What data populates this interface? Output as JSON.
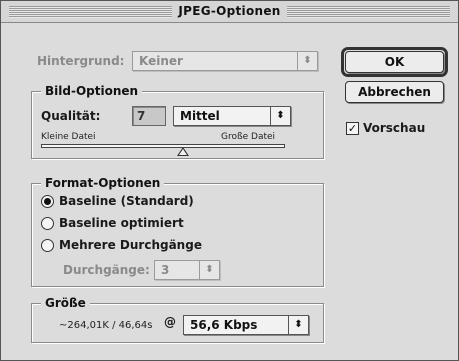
{
  "window": {
    "title": "JPEG-Optionen"
  },
  "background": {
    "label": "Hintergrund:",
    "value": "Keiner"
  },
  "buttons": {
    "ok": "OK",
    "cancel": "Abbrechen"
  },
  "preview": {
    "label": "Vorschau",
    "checked": true
  },
  "bild_optionen": {
    "title": "Bild-Optionen",
    "quality_label": "Qualität:",
    "quality_value": "7",
    "quality_preset": "Mittel",
    "slider_left_label": "Kleine Datei",
    "slider_right_label": "Große Datei",
    "slider_fraction": 0.58
  },
  "format_optionen": {
    "title": "Format-Optionen",
    "options": [
      {
        "label": "Baseline (Standard)",
        "selected": true
      },
      {
        "label": "Baseline optimiert",
        "selected": false
      },
      {
        "label": "Mehrere Durchgänge",
        "selected": false
      }
    ],
    "passes_label": "Durchgänge:",
    "passes_value": "3"
  },
  "groesse": {
    "title": "Größe",
    "size_text": "~264,01K / 46,64s",
    "at_symbol": "@",
    "speed": "56,6 Kbps"
  },
  "icons": {
    "popup_arrow": "⬍",
    "check": "✓"
  }
}
